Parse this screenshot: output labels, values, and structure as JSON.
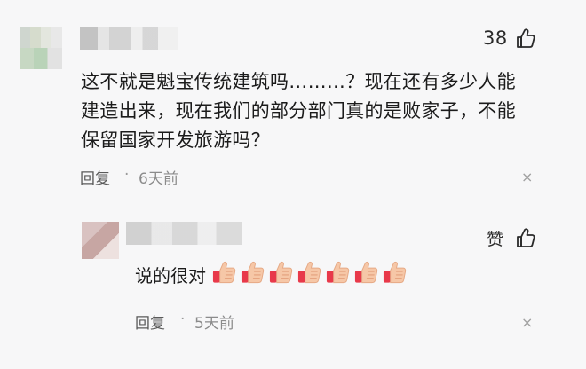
{
  "comment1": {
    "like_count": "38",
    "text": "这不就是魁宝传统建筑吗………？现在还有多少人能建造出来，现在我们的部分部门真的是败家子，不能保留国家开发旅游吗？",
    "reply_label": "回复",
    "dot": "·",
    "time": "6天前",
    "close": "×"
  },
  "reply1": {
    "like_label": "赞",
    "text": "说的很对",
    "emoji": "thumbs-up",
    "emoji_count": 7,
    "reply_label": "回复",
    "dot": "·",
    "time": "5天前",
    "close": "×"
  }
}
